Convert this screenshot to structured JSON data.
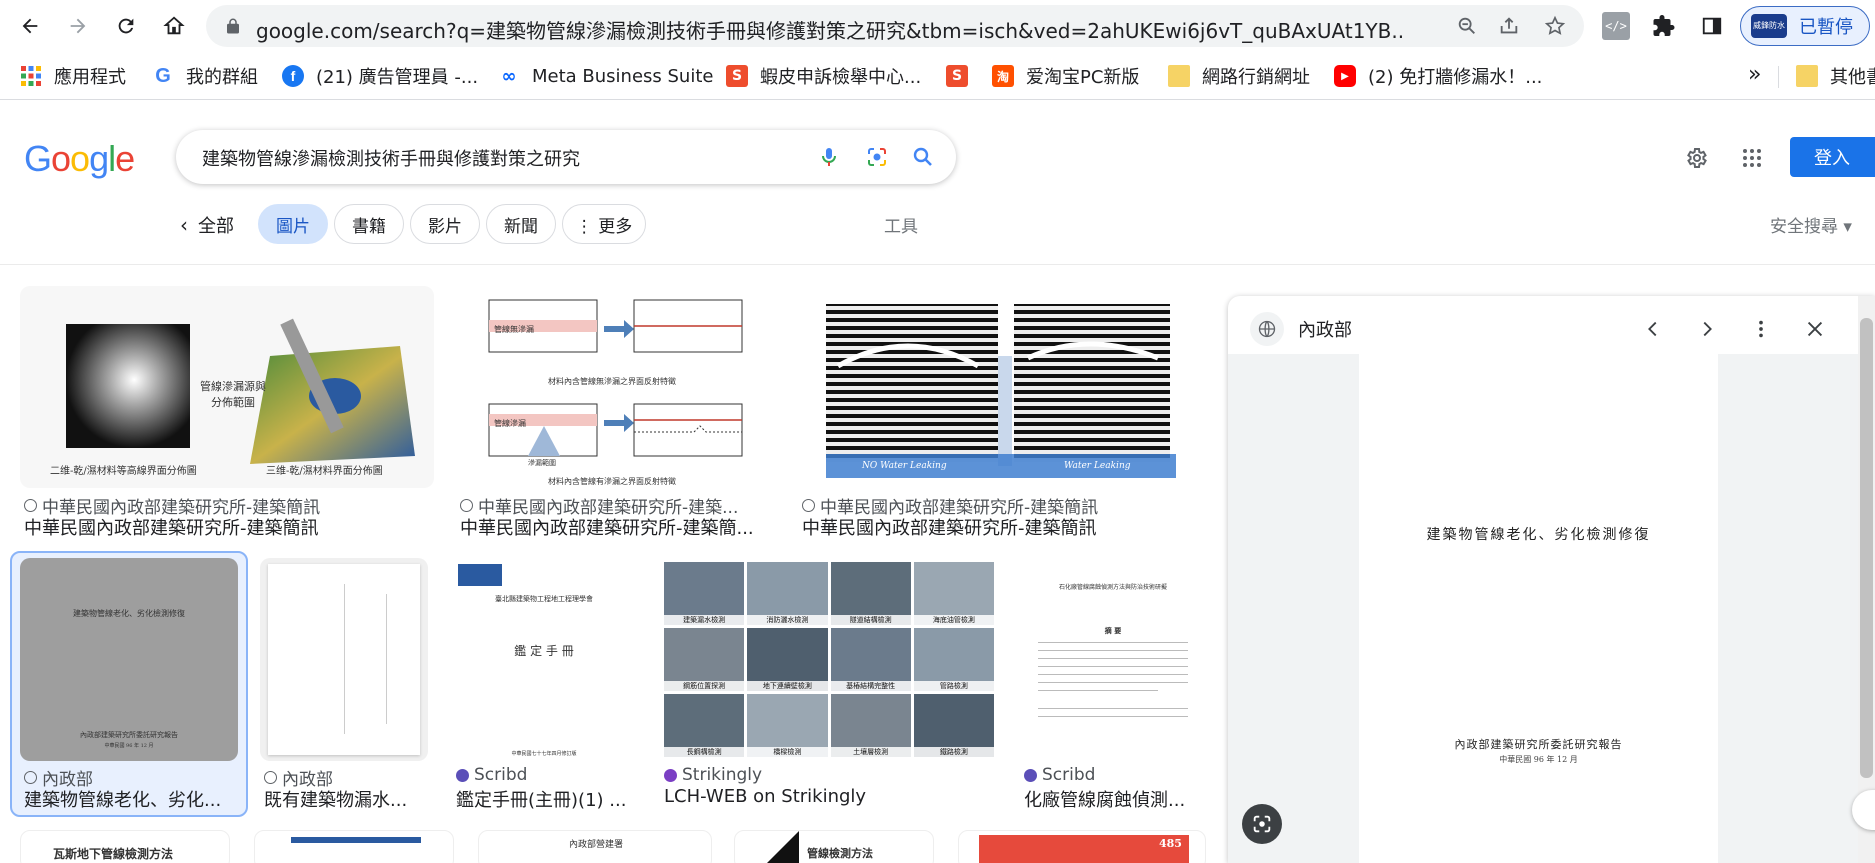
{
  "browser": {
    "url": "google.com/search?q=建築物管線滲漏檢測技術手冊與修護對策之研究&tbm=isch&ved=2ahUKEwi6j6vT_quBAxUAt1YB...",
    "profile_label": "已暫停",
    "profile_avatar_text": "威鋒防水",
    "bookmarks": [
      {
        "label": "應用程式",
        "icon": "apps-grid-icon"
      },
      {
        "label": "我的群組",
        "icon": "google-g-icon"
      },
      {
        "label": "(21) 廣告管理員 -...",
        "icon": "facebook-icon"
      },
      {
        "label": "Meta Business Suite",
        "icon": "meta-icon"
      },
      {
        "label": "蝦皮申訴檢舉中心...",
        "icon": "shopee-icon"
      },
      {
        "label": "",
        "icon": "shopee-icon"
      },
      {
        "label": "爱淘宝PC新版",
        "icon": "taobao-icon"
      },
      {
        "label": "網路行銷網址",
        "icon": "folder-icon"
      },
      {
        "label": "(2) 免打牆修漏水！...",
        "icon": "youtube-icon"
      },
      {
        "label": "其他書",
        "icon": "folder-icon"
      }
    ],
    "bookmarks_more": "»"
  },
  "google": {
    "logo": "Google",
    "query": "建築物管線滲漏檢測技術手冊與修護對策之研究",
    "signin_label": "登入",
    "chips": {
      "back": "全部",
      "images": "圖片",
      "books": "書籍",
      "videos": "影片",
      "news": "新聞",
      "more": "⋮ 更多"
    },
    "tools": "工具",
    "safesearch": "安全搜尋 ▾"
  },
  "results": [
    {
      "source": "中華民國內政部建築研究所-建築簡訊",
      "title": "中華民國內政部建築研究所-建築簡訊",
      "fig_left": "管線滲漏源與分佈範圍",
      "fig_caption_a": "二维-乾/濕材料等高線界面分佈圖",
      "fig_caption_b": "三维-乾/濕材料界面分佈圖"
    },
    {
      "source": "中華民國內政部建築研究所-建築...",
      "title": "中華民國內政部建築研究所-建築簡...",
      "fig_label_a": "管線無滲漏",
      "fig_label_b": "管線滲漏",
      "fig_label_c": "滲漏範圍",
      "fig_caption_a": "材料內含管線無滲漏之界面反射特徵",
      "fig_caption_b": "材料內含管線有滲漏之界面反射特徵"
    },
    {
      "source": "中華民國內政部建築研究所-建築簡訊",
      "title": "中華民國內政部建築研究所-建築簡訊",
      "label_a": "NO Water Leaking",
      "label_b": "Water Leaking"
    },
    {
      "source": "內政部",
      "title": "建築物管線老化、劣化...",
      "doc_title": "建築物管線老化、劣化檢測修復",
      "doc_org": "內政部建築研究所委託研究報告",
      "doc_date": "中華民國 96 年 12 月"
    },
    {
      "source": "內政部",
      "title": "既有建築物漏水..."
    },
    {
      "source": "Scribd",
      "title": "鑑定手冊(主冊)(1) ...",
      "doc_org": "臺北縣建築物工程地工程理學會",
      "doc_title": "鑑 定 手 冊",
      "doc_date": "中華民國七十七年四月修訂版"
    },
    {
      "source": "Strikingly",
      "title": "LCH-WEB on Strikingly",
      "labels": [
        "建築漏水檢測",
        "消防灑水檢測",
        "隧道結構檢測",
        "海底油管檢測",
        "鋼筋位置探測",
        "地下連續壁檢測",
        "基樁結構完整性",
        "管路檢測",
        "長鋼構檢測",
        "橋樑檢測",
        "土壤層檢測",
        "鐵路檢測"
      ]
    },
    {
      "source": "Scribd",
      "title": "化廠管線腐蝕偵測...",
      "doc_title": "石化廠管線腐蝕偵測方法與防治技術研擬",
      "doc_section": "摘 要"
    }
  ],
  "bottom_row": [
    {
      "title": "瓦斯地下管線檢測方法"
    },
    {
      "title": ""
    },
    {
      "title": "內政部營建署"
    },
    {
      "title": "管線檢測方法"
    },
    {
      "title": "485"
    }
  ],
  "panel": {
    "source": "內政部",
    "doc_title": "建築物管線老化、劣化檢測修復",
    "doc_org": "內政部建築研究所委託研究報告",
    "doc_date": "中華民國 96 年 12 月"
  }
}
